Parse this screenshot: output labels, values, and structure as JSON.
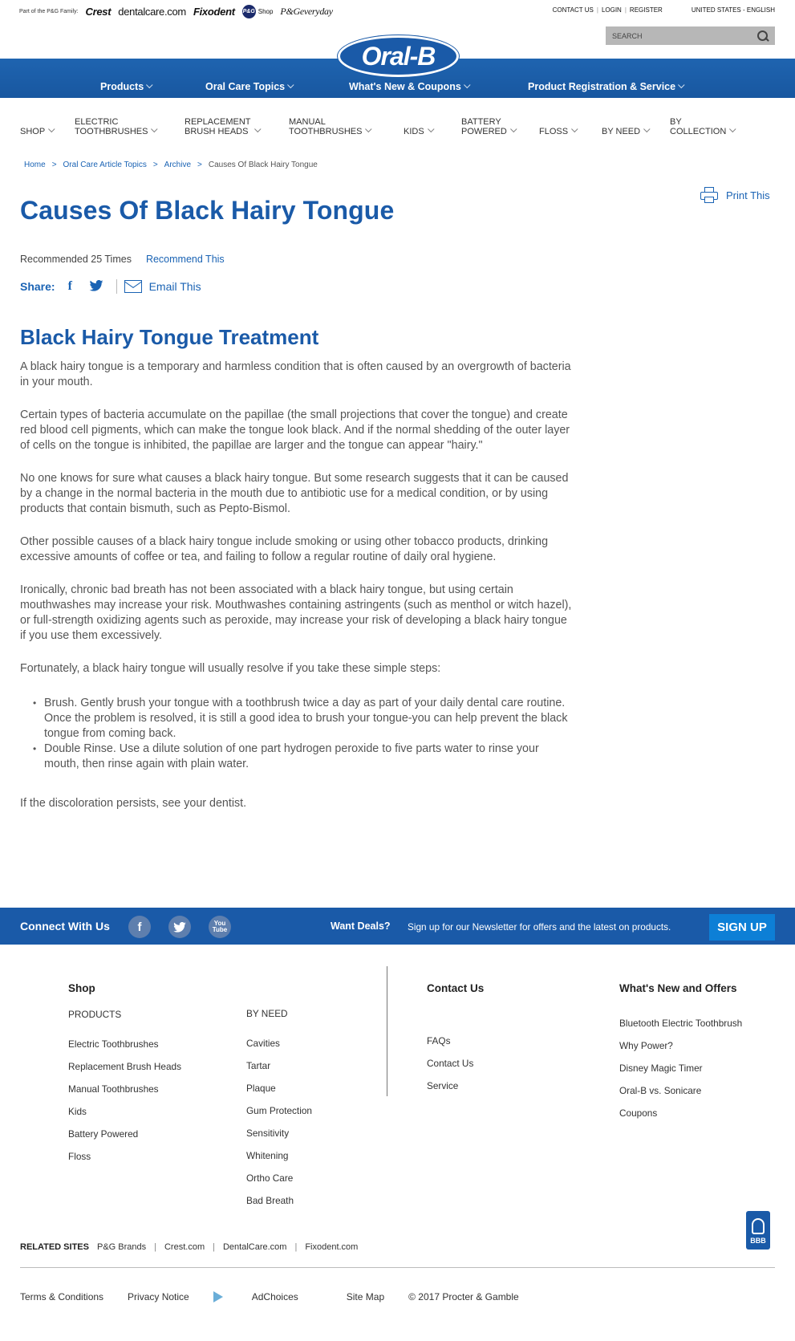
{
  "family": {
    "label": "Part of the P&G Family:",
    "brands": [
      "Crest",
      "dentalcare.com",
      "Fixodent",
      "P&G",
      "Shop",
      "P&Geveryday"
    ]
  },
  "utility": {
    "contact": "CONTACT US",
    "login": "LOGIN",
    "register": "REGISTER",
    "region": "UNITED STATES - ENGLISH"
  },
  "search": {
    "placeholder": "SEARCH"
  },
  "logo": "Oral-B",
  "main_nav": [
    "Products",
    "Oral Care Topics",
    "What's New & Coupons",
    "Product Registration & Service"
  ],
  "product_nav": [
    "SHOP",
    "ELECTRIC\nTOOTHBRUSHES",
    "REPLACEMENT\nBRUSH HEADS",
    "MANUAL\nTOOTHBRUSHES",
    "KIDS",
    "BATTERY\nPOWERED",
    "FLOSS",
    "BY NEED",
    "BY\nCOLLECTION"
  ],
  "breadcrumb": [
    "Home",
    "Oral Care Article Topics",
    "Archive",
    "Causes Of Black Hairy Tongue"
  ],
  "print_label": "Print This",
  "title": "Causes Of Black Hairy Tongue",
  "recommend": {
    "count_text": "Recommended 25 Times",
    "link": "Recommend This"
  },
  "share": {
    "label": "Share:",
    "fb": "f",
    "email": "Email This"
  },
  "article": {
    "heading": "Black Hairy Tongue Treatment",
    "paragraphs": [
      "A black hairy tongue is a temporary and harmless condition that is often caused by an overgrowth of bacteria in your mouth.",
      "Certain types of bacteria accumulate on the papillae (the small projections that cover the tongue) and create red blood cell pigments, which can make the tongue look black. And if the normal shedding of the outer layer of cells on the tongue is inhibited, the papillae are larger and the tongue can appear \"hairy.\"",
      "No one knows for sure what causes a black hairy tongue. But some research suggests that it can be caused by a change in the normal bacteria in the mouth due to antibiotic use for a medical condition, or by using products that contain bismuth, such as Pepto-Bismol.",
      "Other possible causes of a black hairy tongue include smoking or using other tobacco products, drinking excessive amounts of coffee or tea, and failing to follow a regular routine of daily oral hygiene.",
      "Ironically, chronic bad breath has not been associated with a black hairy tongue, but using certain mouthwashes may increase your risk. Mouthwashes containing astringents (such as menthol or witch hazel), or full-strength oxidizing agents such as peroxide, may increase your risk of developing a black hairy tongue if you use them excessively.",
      "Fortunately, a black hairy tongue will usually resolve if you take these simple steps:"
    ],
    "bullets": [
      "Brush. Gently brush your tongue with a toothbrush twice a day as part of your daily dental care routine. Once the problem is resolved, it is still a good idea to brush your tongue-you can help prevent the black tongue from coming back.",
      "Double Rinse. Use a dilute solution of one part hydrogen peroxide to five parts water to rinse your mouth, then rinse again with plain water."
    ],
    "closing": "If the discoloration persists, see your dentist."
  },
  "connect": {
    "title": "Connect With Us",
    "social": [
      "f",
      "t",
      "You Tube"
    ],
    "want_deals": "Want Deals?",
    "signup_text": "Sign up for our Newsletter for offers and the latest on products.",
    "signup_button": "SIGN UP"
  },
  "footer": {
    "shop": {
      "heading": "Shop",
      "products_heading": "PRODUCTS",
      "products": [
        "Electric Toothbrushes",
        "Replacement Brush Heads",
        "Manual Toothbrushes",
        "Kids",
        "Battery Powered",
        "Floss"
      ],
      "need_heading": "BY NEED",
      "need": [
        "Cavities",
        "Tartar",
        "Plaque",
        "Gum Protection",
        "Sensitivity",
        "Whitening",
        "Ortho Care",
        "Bad Breath"
      ]
    },
    "contact": {
      "heading": "Contact Us",
      "links": [
        "FAQs",
        "Contact Us",
        "Service"
      ]
    },
    "whats_new": {
      "heading": "What's New and Offers",
      "links": [
        "Bluetooth Electric Toothbrush",
        "Why Power?",
        "Disney Magic Timer",
        "Oral-B vs. Sonicare",
        "Coupons"
      ]
    },
    "related": {
      "label": "RELATED SITES",
      "links": [
        "P&G Brands",
        "Crest.com",
        "DentalCare.com",
        "Fixodent.com"
      ]
    },
    "bbb": "BBB",
    "legal": [
      "Terms & Conditions",
      "Privacy Notice",
      "AdChoices",
      "Site Map",
      "© 2017 Procter & Gamble"
    ]
  }
}
